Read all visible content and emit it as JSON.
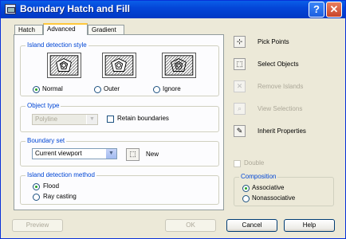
{
  "window": {
    "title": "Boundary Hatch and Fill",
    "help_glyph": "?",
    "close_glyph": "✕"
  },
  "tabs": [
    {
      "label": "Hatch",
      "active": false
    },
    {
      "label": "Advanced",
      "active": true
    },
    {
      "label": "Gradient",
      "active": false
    }
  ],
  "island_style": {
    "legend": "Island detection style",
    "options": [
      {
        "label": "Normal",
        "selected": true
      },
      {
        "label": "Outer",
        "selected": false
      },
      {
        "label": "Ignore",
        "selected": false
      }
    ]
  },
  "object_type": {
    "legend": "Object type",
    "value": "Polyline",
    "enabled": false,
    "retain_label": "Retain boundaries",
    "retain_checked": false
  },
  "boundary_set": {
    "legend": "Boundary set",
    "value": "Current viewport",
    "new_label": "New"
  },
  "detection_method": {
    "legend": "Island detection method",
    "options": [
      {
        "label": "Flood",
        "selected": true
      },
      {
        "label": "Ray casting",
        "selected": false
      }
    ]
  },
  "side_actions": [
    {
      "label": "Pick Points",
      "icon": "pick-points-icon",
      "enabled": true
    },
    {
      "label": "Select Objects",
      "icon": "select-objects-icon",
      "enabled": true
    },
    {
      "label": "Remove Islands",
      "icon": "remove-islands-icon",
      "enabled": false
    },
    {
      "label": "View Selections",
      "icon": "view-selections-icon",
      "enabled": false
    },
    {
      "label": "Inherit Properties",
      "icon": "inherit-properties-icon",
      "enabled": true
    }
  ],
  "double": {
    "label": "Double",
    "checked": false,
    "enabled": false
  },
  "composition": {
    "legend": "Composition",
    "options": [
      {
        "label": "Associative",
        "selected": true
      },
      {
        "label": "Nonassociative",
        "selected": false
      }
    ]
  },
  "footer": {
    "preview": "Preview",
    "ok": "OK",
    "cancel": "Cancel",
    "help": "Help"
  },
  "colors": {
    "title_bar": "#0446d8",
    "legend_text": "#0046d5",
    "window_bg": "#ece9d8"
  }
}
